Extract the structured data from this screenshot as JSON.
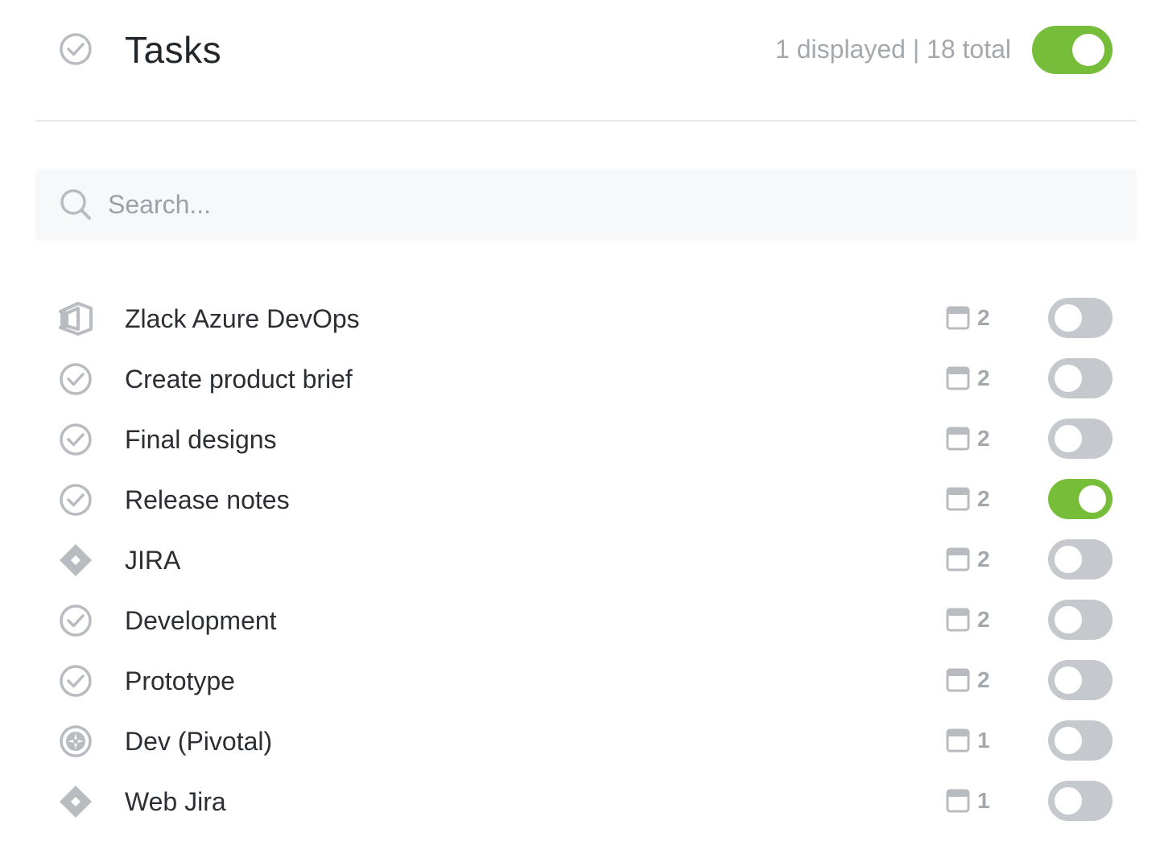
{
  "header": {
    "title": "Tasks",
    "count_text": "1 displayed | 18 total",
    "toggle_on": true
  },
  "search": {
    "placeholder": "Search..."
  },
  "colors": {
    "toggle_on": "#76bd3a",
    "toggle_off": "#c5c9ce",
    "icon_gray": "#b8bcc1"
  },
  "rows": [
    {
      "label": "Zlack Azure DevOps",
      "icon": "azure-devops-icon",
      "count": "2",
      "enabled": false
    },
    {
      "label": "Create product brief",
      "icon": "check-circle-icon",
      "count": "2",
      "enabled": false
    },
    {
      "label": "Final designs",
      "icon": "check-circle-icon",
      "count": "2",
      "enabled": false
    },
    {
      "label": "Release notes",
      "icon": "check-circle-icon",
      "count": "2",
      "enabled": true
    },
    {
      "label": "JIRA",
      "icon": "jira-diamond-icon",
      "count": "2",
      "enabled": false
    },
    {
      "label": "Development",
      "icon": "check-circle-icon",
      "count": "2",
      "enabled": false
    },
    {
      "label": "Prototype",
      "icon": "check-circle-icon",
      "count": "2",
      "enabled": false
    },
    {
      "label": "Dev (Pivotal)",
      "icon": "pivotal-icon",
      "count": "1",
      "enabled": false
    },
    {
      "label": "Web Jira",
      "icon": "jira-diamond-icon",
      "count": "1",
      "enabled": false
    }
  ]
}
